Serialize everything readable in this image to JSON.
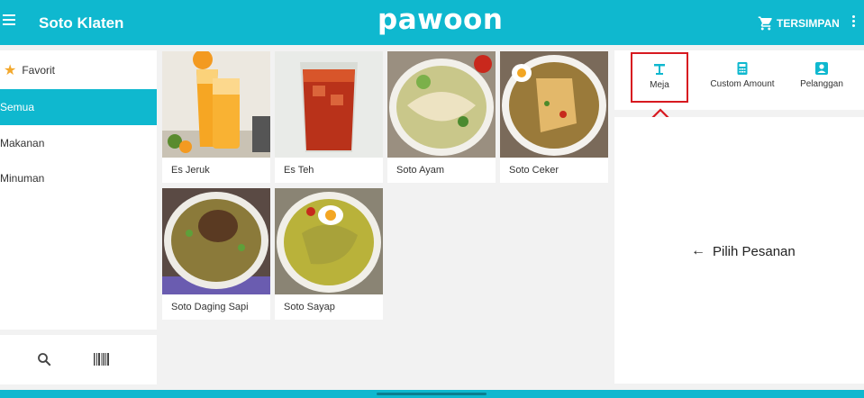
{
  "header": {
    "store_name": "Soto Klaten",
    "logo": "pawoon",
    "saved_label": "TERSIMPAN",
    "menu_icon": "hamburger-menu-icon",
    "cart_icon": "cart-icon",
    "more_icon": "kebab-menu-icon"
  },
  "categories": [
    {
      "label": "Favorit",
      "icon": "star-icon",
      "active": false
    },
    {
      "label": "Semua",
      "active": true
    },
    {
      "label": "Makanan",
      "active": false
    },
    {
      "label": "Minuman",
      "active": false
    }
  ],
  "left_tools": {
    "search_icon": "search-icon",
    "barcode_icon": "barcode-icon"
  },
  "products": [
    {
      "name": "Es Jeruk"
    },
    {
      "name": "Es Teh"
    },
    {
      "name": "Soto Ayam"
    },
    {
      "name": "Soto Ceker"
    },
    {
      "name": "Soto Daging Sapi"
    },
    {
      "name": "Soto Sayap"
    }
  ],
  "actions": [
    {
      "label": "Meja",
      "icon": "table-icon"
    },
    {
      "label": "Custom Amount",
      "icon": "calculator-icon"
    },
    {
      "label": "Pelanggan",
      "icon": "customer-icon"
    }
  ],
  "order_hint": {
    "text": "Pilih Pesanan",
    "arrow": "←"
  },
  "colors": {
    "primary": "#0fb8cf",
    "highlight": "#d71920",
    "star": "#f3a82c"
  }
}
